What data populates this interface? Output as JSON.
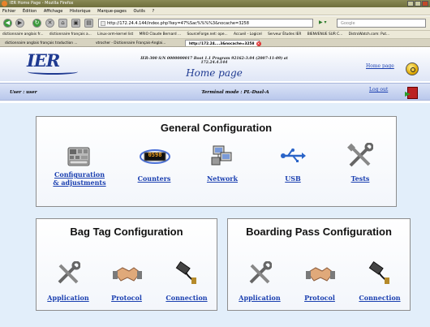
{
  "browser": {
    "title": "IER Home Page - Mozilla Firefox",
    "menu": [
      "Fichier",
      "Édition",
      "Affichage",
      "Historique",
      "Marque-pages",
      "Outils",
      "?"
    ],
    "url": "http://172.24.4.144/index.php?key=47%Sac%%%%3&nocache=3258",
    "search_placeholder": "Google",
    "bookmarks": [
      "dictionnaire anglais fr...",
      "dictionnaire français a...",
      "Linux-arm-kernel list",
      "MRIO Claude Bernard ...",
      "SourceForge.net: ope...",
      "Accueil - Logicel",
      "Serveur Études IER",
      "BIENVENUE SUR C...",
      "DistroWatch.com: Put..."
    ],
    "tabs": [
      "dictionnaire anglais français traduction ...",
      "vtrocher - Dictionnaire Français-Anglai...",
      "http://172.24....3&nocache=3258"
    ]
  },
  "header": {
    "logo_text": "IER",
    "info_line": "IER-300 S/N 0000000017 Boot 1.1 Program 92162-3.04 (2007-11-09) at 172.24.4.144",
    "page_title": "Home page",
    "home_link": "Home page"
  },
  "userbar": {
    "user_label": "User : user",
    "terminal_label": "Terminal mode : PL-Dual-A",
    "logout_link": "Log out"
  },
  "general": {
    "title": "General Configuration",
    "items": [
      {
        "line1": "Configuration",
        "line2": "& adjustments"
      },
      {
        "line1": "Counters",
        "counter_value": "0598"
      },
      {
        "line1": "Network"
      },
      {
        "line1": "USB"
      },
      {
        "line1": "Tests"
      }
    ]
  },
  "bagtag": {
    "title": "Bag Tag Configuration",
    "items": [
      "Application",
      "Protocol",
      "Connection"
    ]
  },
  "boarding": {
    "title": "Boarding Pass Configuration",
    "items": [
      "Application",
      "Protocol",
      "Connection"
    ]
  },
  "colors": {
    "link": "#1a3fb0",
    "logo": "#1f3a91",
    "content_bg": "#e2eefa"
  }
}
